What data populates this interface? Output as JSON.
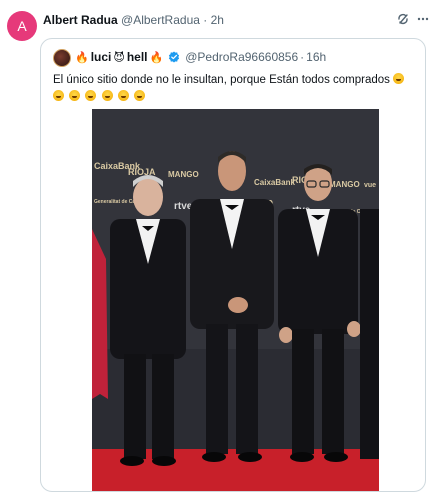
{
  "tweet": {
    "avatar_letter": "A",
    "avatar_color": "#e6397a",
    "author_name": "Albert Radua",
    "author_handle": "@AlbertRadua",
    "separator": "·",
    "time": "2h"
  },
  "quote": {
    "name_prefix_emoji": "🔥",
    "name_part1": "luci",
    "name_mid_emoji": "😈",
    "name_part2": "hell",
    "name_suffix_emoji": "🔥",
    "handle": "@PedroRa96660856",
    "separator": "·",
    "time": "16h",
    "text": "El único sitio donde no le insultan, porque Están todos comprados",
    "laugh_emoji_count_line1": 1,
    "laugh_emoji_count_line2": 6
  },
  "photo_backdrop_text": {
    "brand_caixa": "CaixaBank",
    "brand_rioja": "RIOJA",
    "brand_mango": "MANGO",
    "brand_rtve": "rtve",
    "brand_gencat": "Generalitat de Catalunya",
    "brand_40": "40",
    "brand_vueling": "vue"
  },
  "colors": {
    "accent_blue": "#1d9bf0",
    "border": "#cfd9de",
    "secondary_text": "#536471",
    "red_carpet": "#c8202a"
  },
  "icons": {
    "grok": "grok-icon",
    "more": "more-icon",
    "verified": "verified-badge-icon"
  }
}
